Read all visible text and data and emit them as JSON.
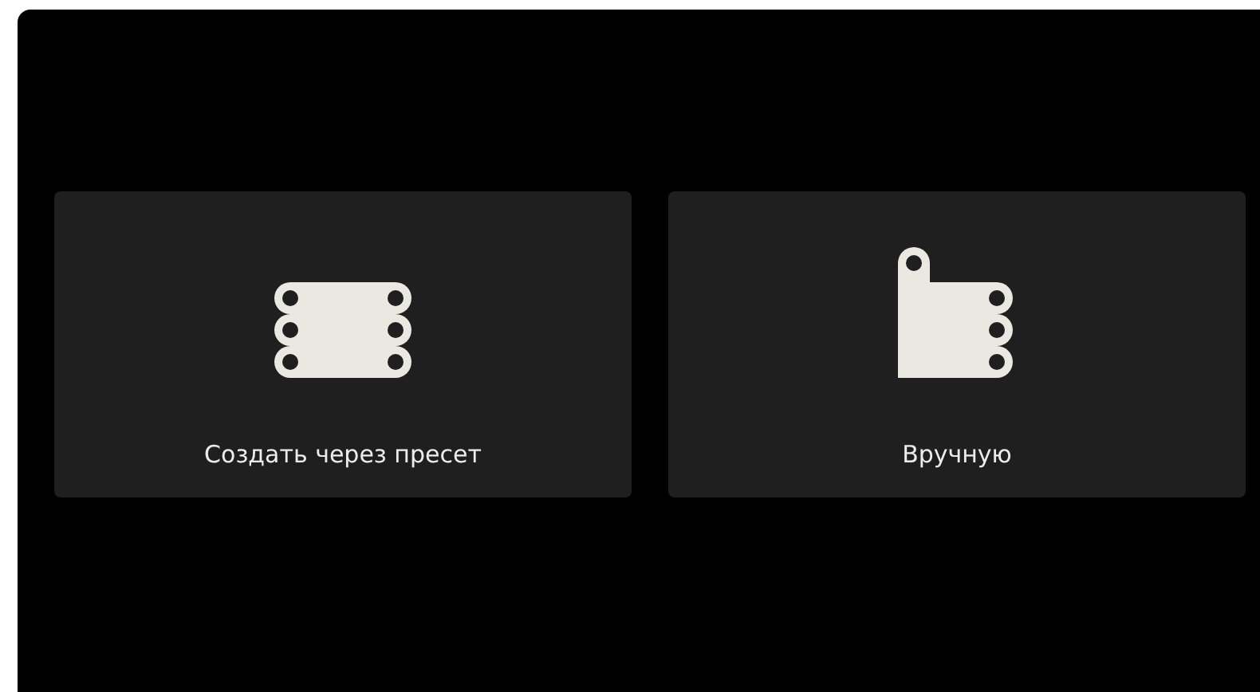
{
  "options": [
    {
      "kind": "preset",
      "label": "Создать через пресет"
    },
    {
      "kind": "manual",
      "label": "Вручную"
    }
  ]
}
